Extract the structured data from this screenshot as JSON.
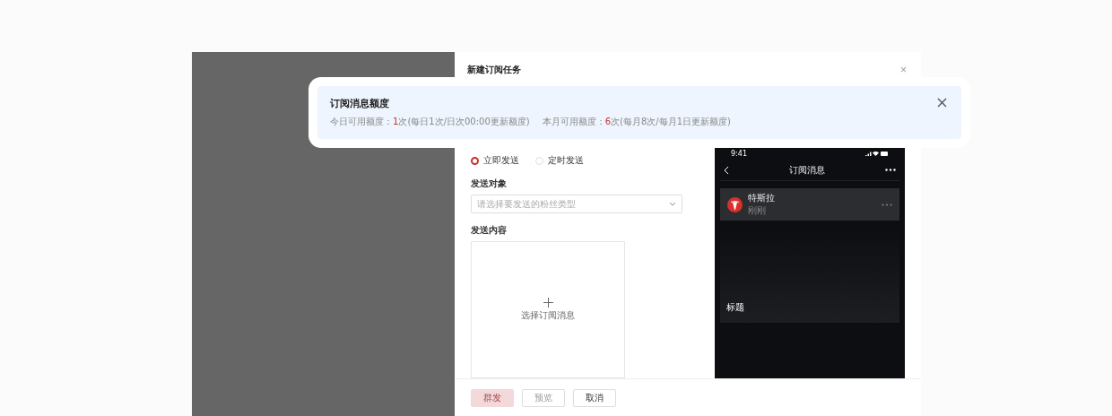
{
  "dialog": {
    "title": "新建订阅任务",
    "close": "×"
  },
  "quota_notice": {
    "title": "订阅消息额度",
    "today_label": "今日可用额度：",
    "today_value": "1",
    "today_suffix": "次(每日1次/日次00:00更新额度)",
    "month_label": "本月可用额度：",
    "month_value": "6",
    "month_suffix": "次(每月8次/每月1日更新额度)"
  },
  "send_mode": [
    {
      "label": "立即发送",
      "selected": true
    },
    {
      "label": "定时发送",
      "selected": false
    }
  ],
  "target": {
    "label": "发送对象",
    "placeholder": "请选择要发送的粉丝类型"
  },
  "content": {
    "label": "发送内容",
    "picker": "选择订阅消息"
  },
  "phone": {
    "time": "9:41",
    "title": "订阅消息",
    "account": "特斯拉",
    "account_sub": "刚刚",
    "card_title": "标题"
  },
  "buttons": [
    {
      "label": "群发",
      "kind": "primary",
      "disabled": true
    },
    {
      "label": "预览",
      "kind": "default",
      "disabled": true
    },
    {
      "label": "取消",
      "kind": "default",
      "disabled": false
    }
  ]
}
